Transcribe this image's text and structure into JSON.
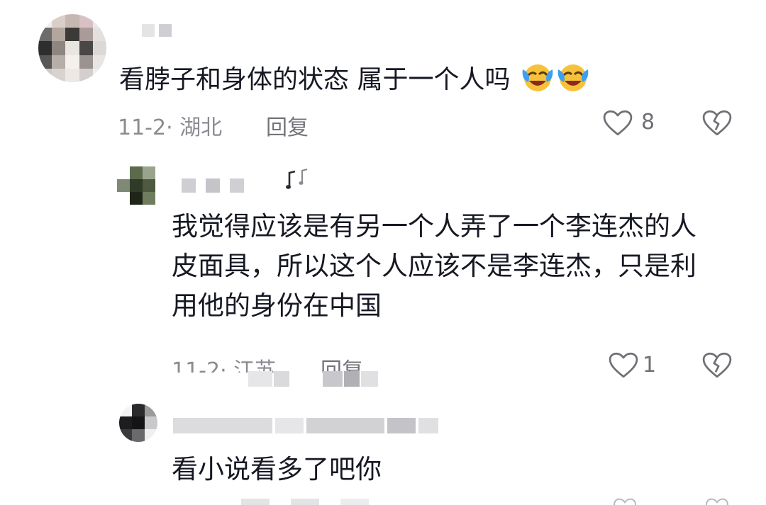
{
  "comment": {
    "text": "看脖子和身体的状态 属于一个人吗",
    "emoji": [
      "tears-of-joy",
      "tears-of-joy"
    ],
    "date_location": "11-2· 湖北",
    "reply_label": "回复",
    "like_count": "8"
  },
  "replies": [
    {
      "text": "我觉得应该是有另一个人弄了一个李连杰的人皮面具，所以这个人应该不是李连杰，只是利用他的身份在中国",
      "date_location": "11-2· 江苏",
      "reply_label": "回复",
      "like_count": "1",
      "badge": "music-note"
    },
    {
      "text": "看小说看多了吧你"
    }
  ],
  "colors": {
    "text": "#161823",
    "meta": "#8a8b91",
    "icon": "#6f7075"
  }
}
